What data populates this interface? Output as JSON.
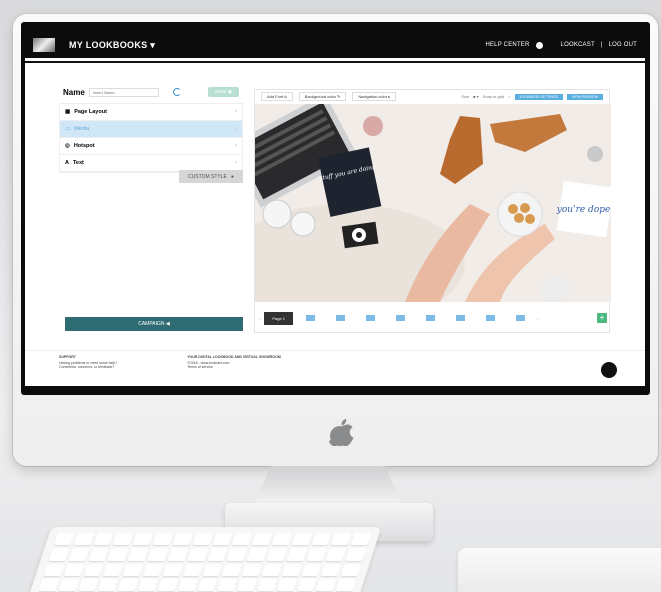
{
  "nav": {
    "title": "MY LOOKBOOKS",
    "help": "HELP CENTER",
    "lookcast": "LOOKCAST",
    "sep": "|",
    "logout": "LOG OUT"
  },
  "left": {
    "name_label": "Name",
    "name_placeholder": "Insert Name",
    "save_label": "SAVE",
    "items": [
      {
        "label": "Page Layout"
      },
      {
        "label": "Media"
      },
      {
        "label": "Hotspot"
      },
      {
        "label": "Text"
      }
    ],
    "custom_style": "CUSTOM STYLE",
    "campaign": "CAMPAIGN"
  },
  "toolbar": {
    "add_font": "Add Font",
    "bg_color": "Background color",
    "nav_color": "Navigation color",
    "size_label": "Size",
    "snap": "Snap to grid",
    "btn1": "LOOKBOOK SETTINGS",
    "btn2": "VIEW PREVIEW"
  },
  "pages": {
    "current": "Page 1"
  },
  "photo": {
    "card_text": "stuff you are doing",
    "dope_text": "you're dope."
  },
  "footer": {
    "support_title": "SUPPORT",
    "support_line1": "Having problems or need some help?",
    "support_line2": "Comments, concerns, or feedback?",
    "col2_title": "YOUR DIGITAL LOOKBOOK AND VIRTUAL SHOWROOM",
    "col2_line1": "©2018 - www.lookcast.com",
    "col2_line2": "Terms of service"
  }
}
